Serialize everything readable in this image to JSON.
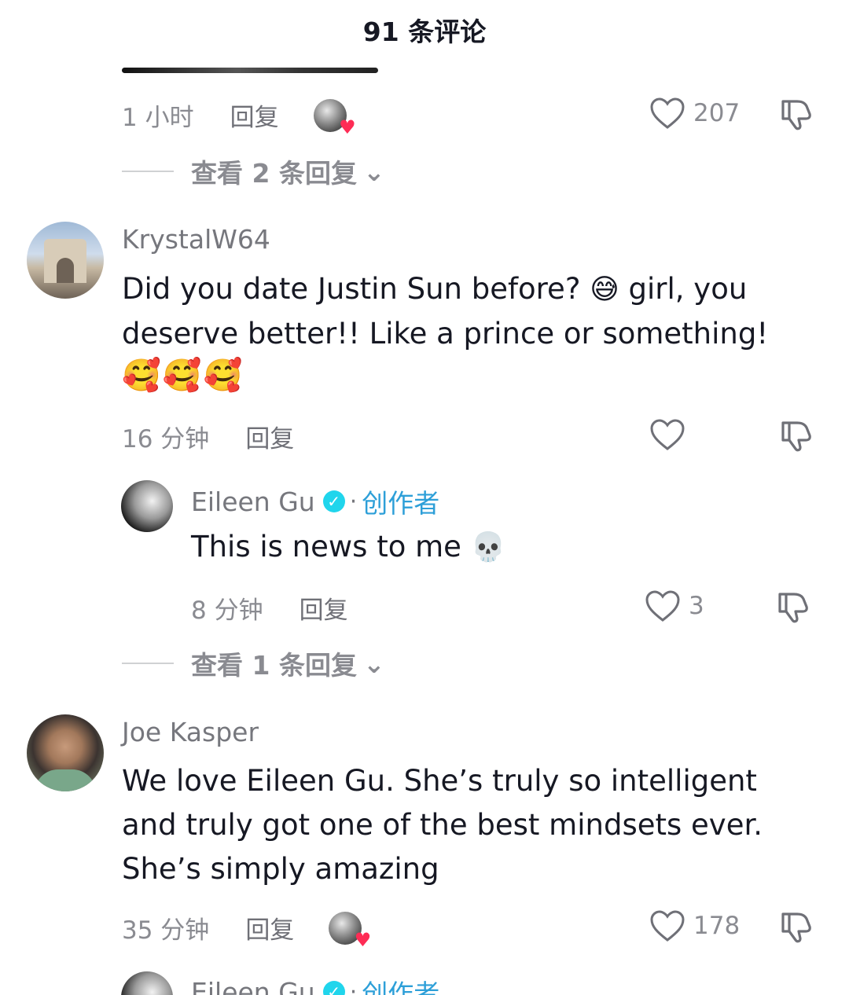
{
  "header": {
    "title": "91 条评论"
  },
  "comments": [
    {
      "time": "1 小时",
      "reply": "回复",
      "likes": "207",
      "view_replies": "查看 2 条回复",
      "chevron": "⌄"
    },
    {
      "username": "KrystalW64",
      "text_part1": "Did you date Justin Sun before? ",
      "emoji_sweat": "😅",
      "text_part2": " girl, you deserve better!! Like a prince or something!",
      "emoji_row": "🥰🥰🥰",
      "time": "16 分钟",
      "reply": "回复",
      "likes": ""
    },
    {
      "username": "Eileen Gu",
      "verified_mark": "✓",
      "dot": "·",
      "badge": "创作者",
      "text": "This is news to me ",
      "emoji_skull": "💀",
      "time": "8 分钟",
      "reply": "回复",
      "likes": "3",
      "view_replies": "查看 1 条回复",
      "chevron": "⌄"
    },
    {
      "username": "Joe Kasper",
      "text": "We love Eileen Gu. She’s truly so intelligent and truly got one of the best mindsets ever. She’s simply amazing",
      "time": "35 分钟",
      "reply": "回复",
      "likes": "178"
    },
    {
      "username": "Eileen Gu",
      "verified_mark": "✓",
      "dot": "·",
      "badge": "创作者"
    }
  ],
  "icons": {
    "liked_heart": "♥",
    "heart_outline": "heart-icon",
    "dislike": "thumbs-down-icon",
    "verified": "verified-badge-icon"
  },
  "colors": {
    "text_primary": "#161823",
    "text_secondary": "#8a8b91",
    "creator_badge": "#2d9fd8",
    "verified": "#20d5ec",
    "liked_heart": "#fe2c55"
  }
}
